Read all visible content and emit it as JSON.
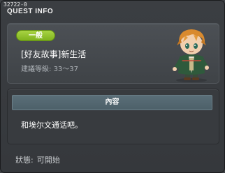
{
  "window": {
    "quest_id": "32722-0",
    "title": "QUEST INFO"
  },
  "quest": {
    "category_badge": "一般",
    "name": "[好友故事]新生活",
    "level_label": "建議等級:",
    "level_range": "33～37",
    "npc_portrait": "npc-portrait"
  },
  "content": {
    "header": "內容",
    "text": "和埃尔文通话吧。"
  },
  "status": {
    "label": "狀態:",
    "value": "可開始"
  },
  "colors": {
    "badge_green": "#8cc22a",
    "content_header": "#55686f",
    "window_bg": "#3b3e42"
  }
}
